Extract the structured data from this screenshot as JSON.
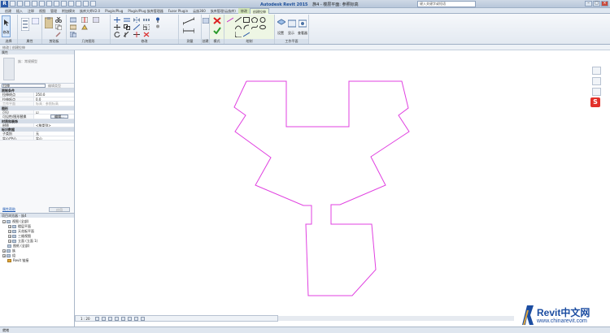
{
  "titlebar": {
    "app_name": "Autodesk Revit 2015",
    "document": "族4 - 楼层平面: 参照标高",
    "search_placeholder": "键入关键字或短语"
  },
  "ribbon_tabs": [
    "创建",
    "插入",
    "注释",
    "视图",
    "管理",
    "附加模块",
    "族库大师V2.0",
    "Plugin/Plug",
    "Plugin/Plug 族库管理器",
    "Fuzor Plugin",
    "云族360",
    "族库管理(云族库)",
    "修改",
    "创建拉伸"
  ],
  "active_tab": "创建拉伸",
  "ribbon_panels": {
    "select": "选择",
    "select_btn": "修改",
    "properties": "属性",
    "clipboard": "剪贴板",
    "geometry": "几何图形",
    "modify": "修改",
    "measure": "测量",
    "create": "创建",
    "mode": "模式",
    "draw": "绘制",
    "work_plane": "工作平面",
    "set": "设置",
    "show": "显示",
    "viewer": "查看器"
  },
  "options_bar": "修改 | 创建拉伸",
  "properties": {
    "header": "属性",
    "type_name": "族：常规模型",
    "selector": "拉伸",
    "edit_type": "编辑类型",
    "groups": [
      {
        "name": "限制条件",
        "rows": [
          {
            "key": "拉伸终点",
            "value": "250.0"
          },
          {
            "key": "拉伸起点",
            "value": "0.0"
          },
          {
            "key": "工作平面",
            "value": "标高 : 参照标高"
          }
        ]
      },
      {
        "name": "图形",
        "rows": [
          {
            "key": "可见",
            "value": "☑"
          },
          {
            "key": "可见性/图形替换",
            "value": "编辑..."
          }
        ]
      },
      {
        "name": "材质和装饰",
        "rows": [
          {
            "key": "材质",
            "value": "<按类别>"
          }
        ]
      },
      {
        "name": "标识数据",
        "rows": [
          {
            "key": "子类别",
            "value": "无"
          },
          {
            "key": "实心/空心",
            "value": "实心"
          }
        ]
      }
    ],
    "help_link": "属性帮助",
    "apply": "应用"
  },
  "project_browser": {
    "header": "项目浏览器 - 族4",
    "nodes": [
      {
        "label": "视图 (全部)",
        "level": 0,
        "exp": "−"
      },
      {
        "label": "楼层平面",
        "level": 1,
        "exp": "+"
      },
      {
        "label": "天花板平面",
        "level": 1,
        "exp": "+"
      },
      {
        "label": "三维视图",
        "level": 1,
        "exp": "+"
      },
      {
        "label": "立面 (立面 1)",
        "level": 1,
        "exp": "+"
      },
      {
        "label": "图纸 (全部)",
        "level": 0,
        "exp": ""
      },
      {
        "label": "族",
        "level": 0,
        "exp": "+"
      },
      {
        "label": "组",
        "level": 0,
        "exp": "+"
      },
      {
        "label": "Revit 链接",
        "level": 0,
        "exp": ""
      }
    ]
  },
  "view_scale": "1 : 20",
  "status": "就绪",
  "watermark": {
    "brand": "Revit中文网",
    "url": "www.chinarevit.com"
  },
  "colors": {
    "sketch_line": "#e040e0",
    "accent": "#2b5aa8"
  }
}
